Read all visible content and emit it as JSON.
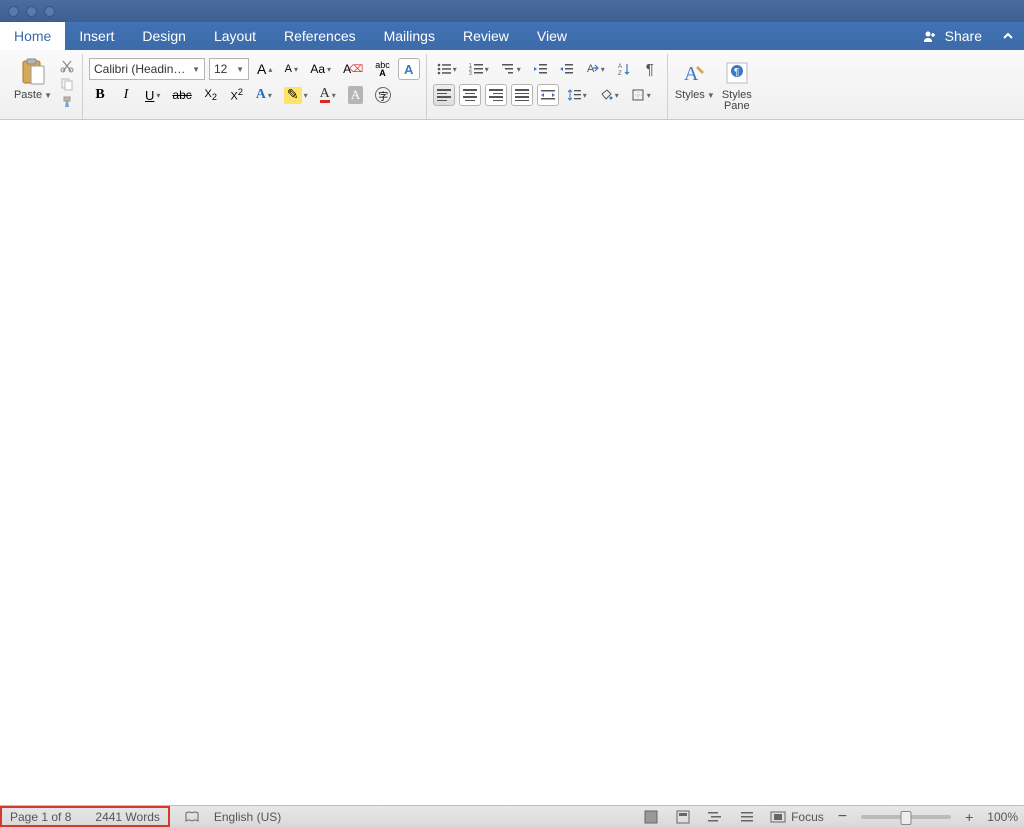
{
  "tabs": [
    "Home",
    "Insert",
    "Design",
    "Layout",
    "References",
    "Mailings",
    "Review",
    "View"
  ],
  "active_tab": "Home",
  "share_label": "Share",
  "clipboard": {
    "paste_label": "Paste"
  },
  "font": {
    "name": "Calibri (Headin…",
    "size": "12",
    "bold": "B",
    "italic": "I",
    "underline": "U",
    "strike": "abc",
    "subscript": "X",
    "subscript_sub": "2",
    "superscript": "X",
    "superscript_sup": "2",
    "clear_label": "abc",
    "enclose": "字"
  },
  "styles": {
    "styles_label": "Styles",
    "pane_label": "Styles\nPane"
  },
  "status": {
    "page": "Page 1 of 8",
    "words": "2441 Words",
    "language": "English (US)",
    "focus": "Focus",
    "zoom": "100%"
  }
}
